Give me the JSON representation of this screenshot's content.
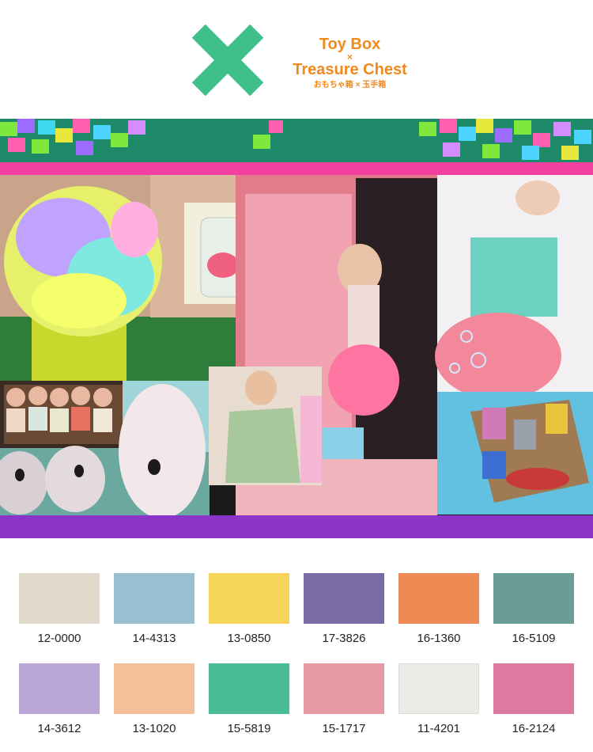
{
  "header": {
    "title_line1": "Toy Box",
    "title_x": "×",
    "title_line2": "Treasure Chest",
    "subtitle": "おもちゃ箱 × 玉手箱",
    "logo_color": "#3fbf8a",
    "title_color": "#f08a1c"
  },
  "collage": {
    "photos": [
      "lego-bricks-strip",
      "tutu-on-head",
      "butterfly-jar",
      "pink-kitchen-girl",
      "bubble-dancer",
      "doll-babies",
      "bunny-plush",
      "woman-blowing-kiss",
      "tin-robots-box"
    ],
    "band_colors": [
      "#f23fa0",
      "#8a35c8"
    ]
  },
  "palette": [
    {
      "code": "12-0000",
      "color": "#e0d8cb"
    },
    {
      "code": "14-4313",
      "color": "#98c0d0"
    },
    {
      "code": "13-0850",
      "color": "#f6d45a"
    },
    {
      "code": "17-3826",
      "color": "#7b6ba4"
    },
    {
      "code": "16-1360",
      "color": "#f08a55"
    },
    {
      "code": "16-5109",
      "color": "#6c9c96"
    },
    {
      "code": "14-3612",
      "color": "#b9a5d6"
    },
    {
      "code": "13-1020",
      "color": "#f6c09a"
    },
    {
      "code": "15-5819",
      "color": "#4abc96"
    },
    {
      "code": "15-1717",
      "color": "#e89aa4"
    },
    {
      "code": "11-4201",
      "color": "#ebebe8"
    },
    {
      "code": "16-2124",
      "color": "#de7aa2"
    }
  ]
}
